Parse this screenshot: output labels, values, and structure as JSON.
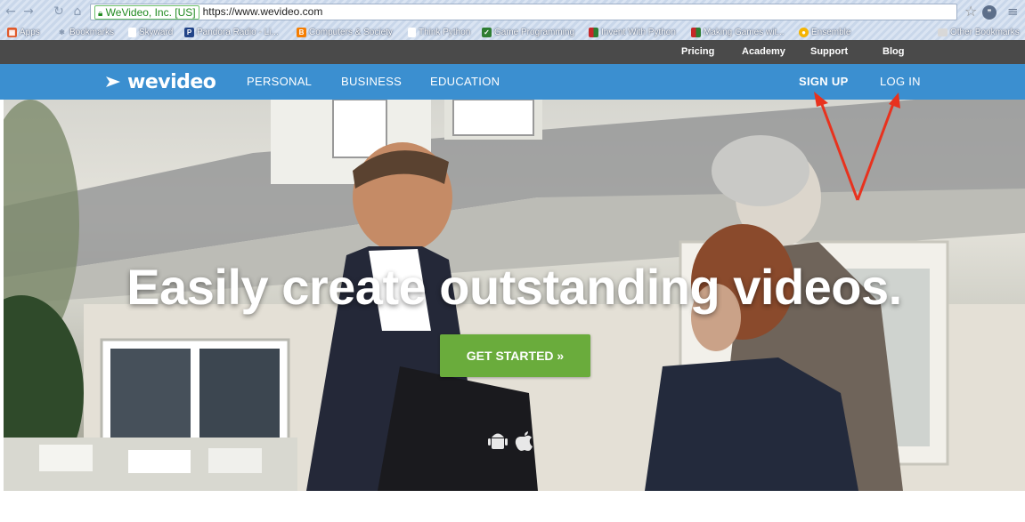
{
  "browser": {
    "site_identity": "WeVideo, Inc. [US]",
    "url": "https://www.wevideo.com",
    "bookmarks": [
      {
        "label": "Apps",
        "icon": "apps-grid-icon",
        "color": "#e05a2b"
      },
      {
        "label": "Bookmarks",
        "icon": "star-icon",
        "color": "#8a9bb3"
      },
      {
        "label": "Skyward",
        "icon": "page-icon",
        "color": "#ffffff"
      },
      {
        "label": "Pandora Radio - Li...",
        "icon": "pandora-icon",
        "color": "#224488"
      },
      {
        "label": "Computers & Society",
        "icon": "blogger-icon",
        "color": "#f57d00"
      },
      {
        "label": "Think Python",
        "icon": "page-icon",
        "color": "#ffffff"
      },
      {
        "label": "Game Programming",
        "icon": "game-icon",
        "color": "#2e7d32"
      },
      {
        "label": "Invent With Python",
        "icon": "python-icon",
        "color": "#c62828"
      },
      {
        "label": "Making Games wit...",
        "icon": "python-icon",
        "color": "#c62828"
      },
      {
        "label": "Ensemble",
        "icon": "ensemble-icon",
        "color": "#f5b400"
      },
      {
        "label": "Other Bookmarks",
        "icon": "folder-icon",
        "color": "#d8d8d8"
      }
    ]
  },
  "site": {
    "top_links": [
      "Pricing",
      "Academy",
      "Support",
      "Blog"
    ],
    "logo_text": "wevideo",
    "nav_left": [
      "PERSONAL",
      "BUSINESS",
      "EDUCATION"
    ],
    "sign_up": "SIGN UP",
    "log_in": "LOG IN",
    "headline": "Easily create outstanding videos.",
    "cta": "GET STARTED »",
    "platform_icons": [
      "android-icon",
      "apple-icon"
    ],
    "colors": {
      "nav_blue": "#3b8fd0",
      "topbar": "#4a4a4a",
      "cta_green": "#6aac3c",
      "annotation_red": "#e8321e"
    }
  }
}
